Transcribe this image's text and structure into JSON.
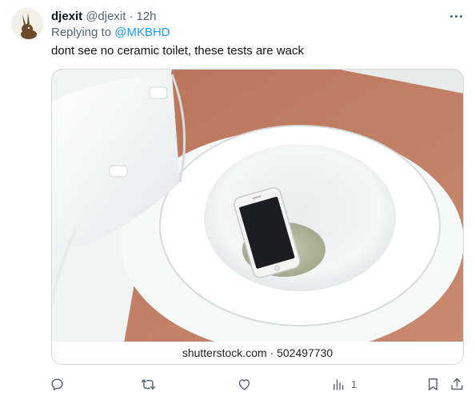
{
  "tweet": {
    "display_name": "djexit",
    "handle": "@djexit",
    "separator": "·",
    "timestamp": "12h",
    "replying_to_prefix": "Replying to ",
    "replying_to_handle": "@MKBHD",
    "text": "dont see no ceramic toilet, these tests are wack",
    "media": {
      "watermark": "shutterstock.com · 502497730"
    },
    "actions": {
      "reply_icon": "reply-icon",
      "retweet_icon": "retweet-icon",
      "like_icon": "heart-icon",
      "views_icon": "bar-chart-icon",
      "views_count": "1",
      "bookmark_icon": "bookmark-icon",
      "share_icon": "share-icon"
    }
  },
  "colors": {
    "link": "#1d9bf0",
    "muted": "#536471",
    "text": "#0f1419",
    "border": "#cfd9de"
  }
}
